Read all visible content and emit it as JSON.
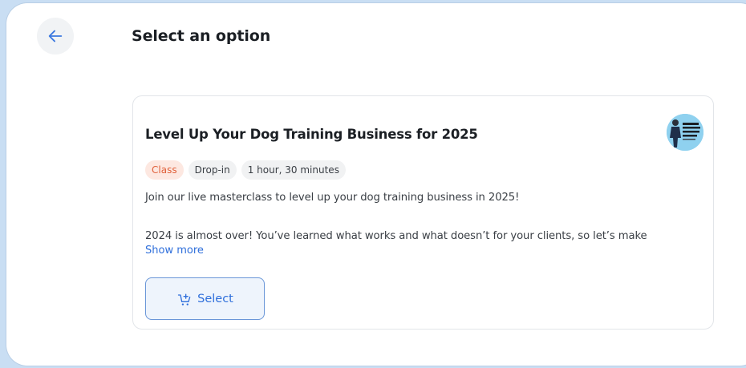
{
  "header": {
    "back_icon": "arrow-left-icon",
    "title": "Select an option"
  },
  "card": {
    "title": "Level Up Your Dog Training Business for 2025",
    "tags": [
      "Class",
      "Drop-in",
      "1 hour, 30 minutes"
    ],
    "description_line_1": "Join our live masterclass to level up your dog training business in 2025!",
    "description_line_2": "2024 is almost over! You’ve learned what works and what doesn’t for your clients, so let’s make",
    "show_more_label": "Show more",
    "select_label": "Select",
    "select_icon": "cart-add-icon",
    "thumbnail_icon": "event-thumbnail"
  },
  "colors": {
    "accent": "#2f6fdb",
    "class_tag_text": "#e0603a",
    "class_tag_bg": "#fde8e1",
    "backdrop": "#c9def3"
  }
}
